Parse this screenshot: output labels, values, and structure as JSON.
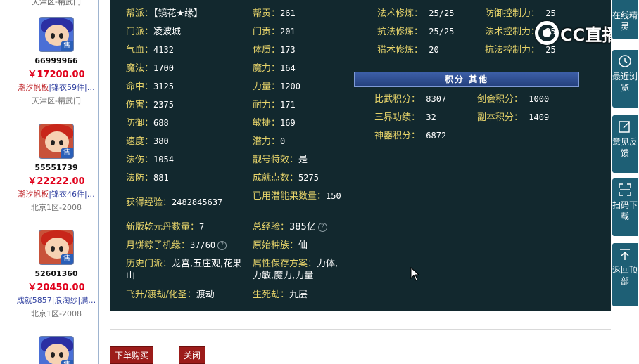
{
  "left_listings": [
    {
      "top_region": "天津区-精武门"
    },
    {
      "id": "66999966",
      "price": "￥17200.00",
      "tag1": "潮汐帆板",
      "tag2": "锦衣59件",
      "tag3": "…",
      "region": "天津区-精武门",
      "badge": "售"
    },
    {
      "id": "55551739",
      "price": "￥22222.00",
      "tag1": "潮汐帆板",
      "tag2": "锦衣46件",
      "tag3": "…",
      "region": "北京1区-2008",
      "badge": "售"
    },
    {
      "id": "52601360",
      "price": "￥20450.00",
      "tag1": "成就5857",
      "tag2": "浪淘纱",
      "tag3": "满…",
      "region": "北京1区-2008",
      "badge": "售"
    },
    {
      "badge": "售"
    }
  ],
  "stats": {
    "bangpai": {
      "label": "帮派：",
      "value": "【镜花★缘】"
    },
    "menpai": {
      "label": "门派：",
      "value": "凌波城"
    },
    "qixue": {
      "label": "气血：",
      "value": "4132"
    },
    "mofa": {
      "label": "魔法：",
      "value": "1700"
    },
    "mingzhong": {
      "label": "命中：",
      "value": "3125"
    },
    "shanghai": {
      "label": "伤害：",
      "value": "2375"
    },
    "fangyu": {
      "label": "防御：",
      "value": "688"
    },
    "sudu": {
      "label": "速度：",
      "value": "380"
    },
    "fashang": {
      "label": "法伤：",
      "value": "1054"
    },
    "fafang": {
      "label": "法防：",
      "value": "881"
    },
    "huodejingyan": {
      "label": "获得经验：",
      "value": "2482845637"
    },
    "qianyuandan": {
      "label": "新版乾元丹数量：",
      "value": "7"
    },
    "yuebing": {
      "label": "月饼粽子机缘：",
      "value": "37/60"
    },
    "lishimenpai": {
      "label": "历史门派：",
      "value": "龙宫,五庄观,花果山"
    },
    "feisheng": {
      "label": "飞升/渡劫/化圣：",
      "value": "渡劫"
    },
    "banggong": {
      "label": "帮贡：",
      "value": "261"
    },
    "mengong": {
      "label": "门贡：",
      "value": "201"
    },
    "tizhi": {
      "label": "体质：",
      "value": "173"
    },
    "moli": {
      "label": "魔力：",
      "value": "164"
    },
    "liliang": {
      "label": "力量：",
      "value": "1200"
    },
    "naili": {
      "label": "耐力：",
      "value": "171"
    },
    "minjie": {
      "label": "敏捷：",
      "value": "169"
    },
    "qianli": {
      "label": "潜力：",
      "value": "0"
    },
    "lianghao": {
      "label": "靓号特效：",
      "value": "是"
    },
    "chengjiu": {
      "label": "成就点数：",
      "value": "5275"
    },
    "qiannengguo": {
      "label": "已用潜能果数量：",
      "value": "150"
    },
    "zongjingyan": {
      "label": "总经验：",
      "value": "385亿"
    },
    "yuanshi": {
      "label": "原始种族：",
      "value": "仙"
    },
    "shuxing": {
      "label": "属性保存方案：",
      "value": "力体,力敏,魔力,力量"
    },
    "shengsijie": {
      "label": "生死劫：",
      "value": "九层"
    },
    "fashuxiulian": {
      "label": "法术修炼：",
      "value": "25/25"
    },
    "kangfaxiulian": {
      "label": "抗法修炼：",
      "value": "25/25"
    },
    "lieshuxiulian": {
      "label": "猎术修炼：",
      "value": "20"
    },
    "fangyukongzhi": {
      "label": "防御控制力：",
      "value": "25"
    },
    "fashukongzhi": {
      "label": "法术控制力：",
      "value": "25"
    },
    "kangfakongzhi": {
      "label": "抗法控制力：",
      "value": "25"
    }
  },
  "scores": {
    "header": "积分 其他",
    "biwu": {
      "label": "比武积分：",
      "value": "8307"
    },
    "jianhui": {
      "label": "剑会积分：",
      "value": "1000"
    },
    "sanjie": {
      "label": "三界功绩：",
      "value": "32"
    },
    "fuben": {
      "label": "副本积分：",
      "value": "1409"
    },
    "shenqi": {
      "label": "神器积分：",
      "value": "6872"
    }
  },
  "buttons": {
    "order": "下单购买",
    "close": "关闭"
  },
  "overlay": {
    "logo_text": "CC直播"
  },
  "right_bar": {
    "online": "在线精灵",
    "recent": "最近浏览",
    "feedback": "意见反馈",
    "scan": "扫码下载",
    "top": "返回顶部"
  },
  "colors": {
    "panel_bg": "#12282e",
    "label": "#e6d36a",
    "value": "#ffffff",
    "accent_bar": "#1e5f75",
    "price": "#e0001b",
    "button": "#9c1c1a"
  }
}
